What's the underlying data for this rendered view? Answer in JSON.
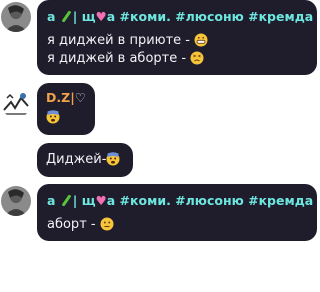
{
  "messages": [
    {
      "sender": {
        "prefix": "а ",
        "middle": "| щ",
        "suffix": "а #коми. #люсоню #кремда"
      },
      "lines": [
        {
          "text": "я диджей в приюте - ",
          "emoji": "grinning-emoji"
        },
        {
          "text": "я диджей в аборте - ",
          "emoji": "persevering-emoji"
        }
      ]
    },
    {
      "sender": {
        "name": "D.Z|",
        "heart": "♡"
      },
      "lines": [
        {
          "emoji": "fearful-emoji"
        }
      ]
    },
    {
      "lines": [
        {
          "text": "Диджей-",
          "emoji": "fearful-emoji"
        }
      ]
    },
    {
      "sender": {
        "prefix": "а ",
        "middle": "| щ",
        "suffix": "а #коми. #люсоню #кремда"
      },
      "lines": [
        {
          "text": "аборт - ",
          "emoji": "neutral-emoji"
        }
      ]
    }
  ],
  "colors": {
    "bubble": "#1f1c2c",
    "sender_name": "#6ee7de",
    "dz_name": "#f0a24a",
    "heart": "#f06fb5",
    "message_text": "#f3f3f6"
  }
}
